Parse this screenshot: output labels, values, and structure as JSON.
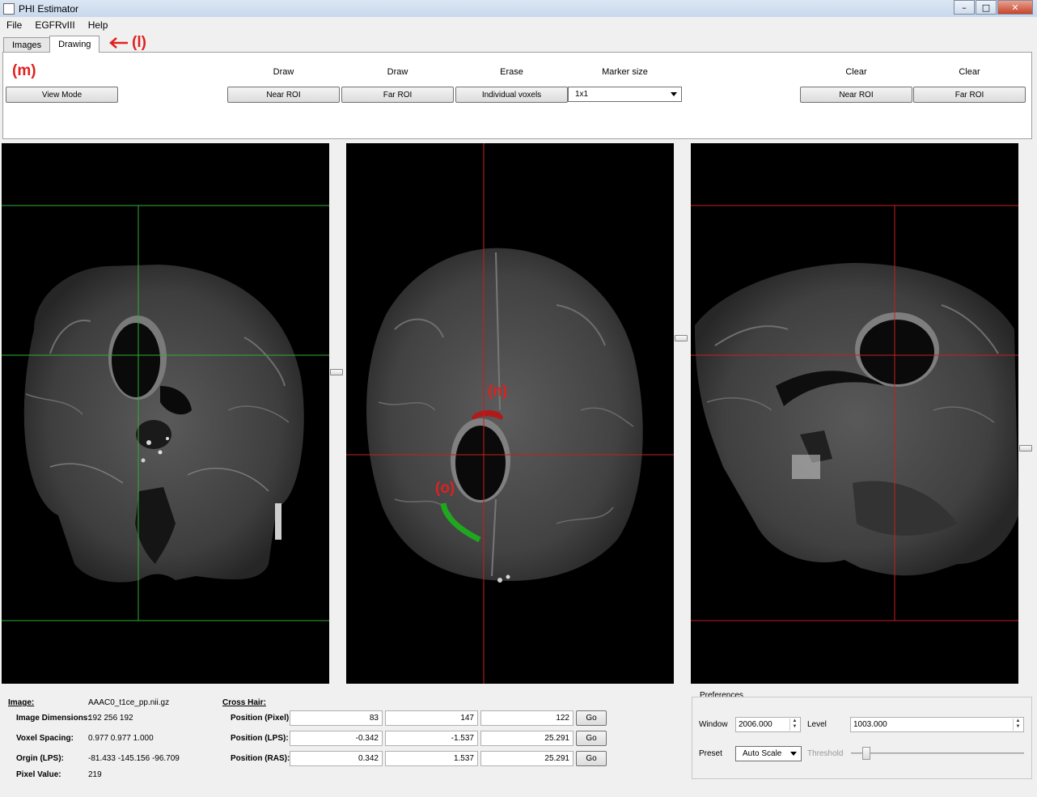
{
  "window": {
    "title": "PHI Estimator",
    "minimize": "–",
    "maximize": "□",
    "close": "✕"
  },
  "menu": [
    "File",
    "EGFRvIII",
    "Help"
  ],
  "tabs": {
    "images": "Images",
    "drawing": "Drawing"
  },
  "annotations": {
    "l": "(l)",
    "m": "(m)",
    "n": "(n)",
    "o": "(o)",
    "arrow": "🡐"
  },
  "drawing": {
    "view_mode": "View Mode",
    "draw1_label": "Draw",
    "draw1_button": "Near ROI",
    "draw2_label": "Draw",
    "draw2_button": "Far ROI",
    "erase_label": "Erase",
    "erase_button": "Individual voxels",
    "marker_label": "Marker size",
    "marker_value": "1x1",
    "clear1_label": "Clear",
    "clear1_button": "Near ROI",
    "clear2_label": "Clear",
    "clear2_button": "Far ROI"
  },
  "image_info": {
    "heading": "Image:",
    "filename": "AAAC0_t1ce_pp.nii.gz",
    "dimensions_label": "Image Dimensions:",
    "dimensions": "192  256  192",
    "spacing_label": "Voxel Spacing:",
    "spacing": "0.977  0.977  1.000",
    "origin_label": "Orgin (LPS):",
    "origin": "-81.433  -145.156  -96.709",
    "pixel_label": "Pixel Value:",
    "pixel": "219"
  },
  "crosshair": {
    "heading": "Cross Hair:",
    "pixel_label": "Position (Pixel):",
    "pixel": [
      "83",
      "147",
      "122"
    ],
    "lps_label": "Position (LPS):",
    "lps": [
      "-0.342",
      "-1.537",
      "25.291"
    ],
    "ras_label": "Position (RAS):",
    "ras": [
      "0.342",
      "1.537",
      "25.291"
    ],
    "go": "Go"
  },
  "preferences": {
    "heading": "Preferences",
    "window_label": "Window",
    "window_value": "2006.000",
    "level_label": "Level",
    "level_value": "1003.000",
    "preset_label": "Preset",
    "preset_value": "Auto Scale",
    "threshold_label": "Threshold"
  },
  "colors": {
    "crosshair_coronal": "#2fae2f",
    "crosshair_other": "#c81e1e",
    "near_roi": "#b21a1a",
    "far_roi": "#1fa81f",
    "annotation": "#e02020"
  }
}
